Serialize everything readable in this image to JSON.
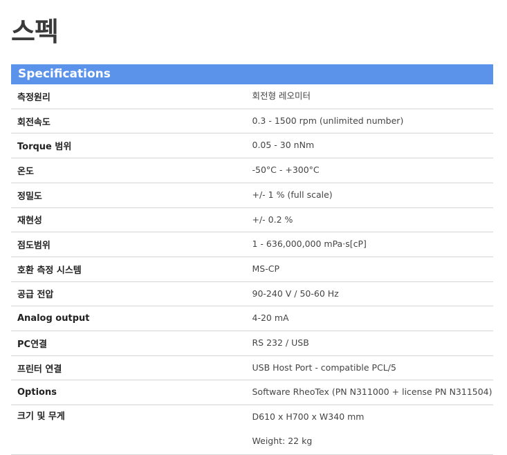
{
  "page_title": "스펙",
  "table": {
    "header": "Specifications",
    "rows": [
      {
        "label": "측정원리",
        "values": [
          "회전형 레오미터"
        ]
      },
      {
        "label": "회전속도",
        "values": [
          "0.3 - 1500 rpm (unlimited number)"
        ]
      },
      {
        "label": "Torque 범위",
        "values": [
          "0.05 - 30 nNm"
        ]
      },
      {
        "label": "온도",
        "values": [
          "-50°C - +300°C"
        ]
      },
      {
        "label": "정밀도",
        "values": [
          "+/- 1 % (full scale)"
        ]
      },
      {
        "label": "재현성",
        "values": [
          "+/- 0.2 %"
        ]
      },
      {
        "label": "점도범위",
        "values": [
          "1 - 636,000,000 mPa·s[cP]"
        ]
      },
      {
        "label": "호환 측정 시스템",
        "values": [
          "MS-CP"
        ]
      },
      {
        "label": "공급 전압",
        "values": [
          "90-240 V / 50-60 Hz"
        ]
      },
      {
        "label": "Analog output",
        "values": [
          "4-20 mA"
        ]
      },
      {
        "label": "PC연결",
        "values": [
          "RS 232 / USB"
        ]
      },
      {
        "label": "프린터 연결",
        "values": [
          "USB Host Port - compatible PCL/5"
        ]
      },
      {
        "label": "Options",
        "values": [
          "Software RheoTex (PN N311000 + license PN N311504)"
        ]
      },
      {
        "label": "크기 및 무게",
        "values": [
          "D610 x H700 x W340 mm",
          "Weight: 22 kg"
        ]
      }
    ]
  },
  "colors": {
    "header_background": "#5b93ea",
    "header_text": "#ffffff",
    "row_divider": "#d4d4d4"
  }
}
